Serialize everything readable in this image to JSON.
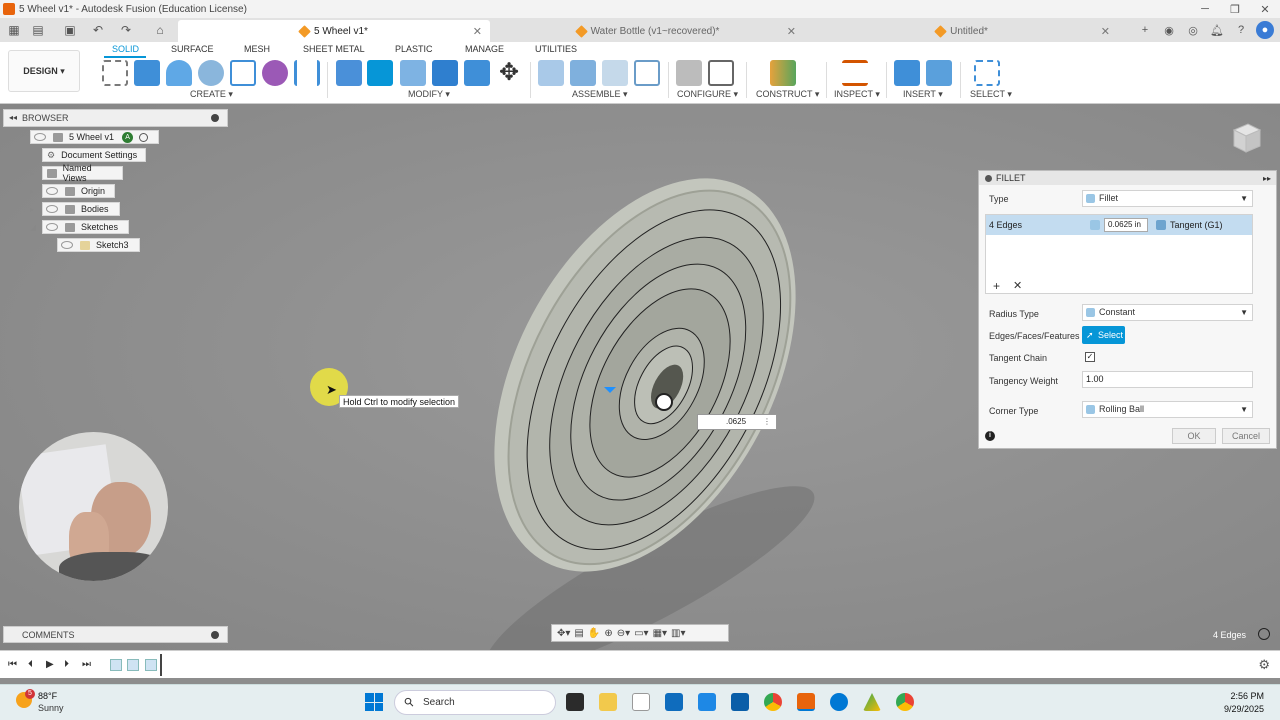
{
  "window": {
    "title": "5 Wheel v1* - Autodesk Fusion (Education License)"
  },
  "tabs": [
    {
      "label": "5 Wheel v1*",
      "active": true
    },
    {
      "label": "Water Bottle (v1~recovered)*",
      "active": false
    },
    {
      "label": "Untitled*",
      "active": false
    }
  ],
  "ribbon": {
    "workspace": "DESIGN",
    "workspace_tabs": [
      "SOLID",
      "SURFACE",
      "MESH",
      "SHEET METAL",
      "PLASTIC",
      "MANAGE",
      "UTILITIES"
    ],
    "groups": [
      "CREATE",
      "MODIFY",
      "ASSEMBLE",
      "CONFIGURE",
      "CONSTRUCT",
      "INSPECT",
      "INSERT",
      "SELECT"
    ]
  },
  "browser": {
    "header": "BROWSER",
    "root": "5 Wheel v1",
    "root_badge": "A",
    "items": [
      "Document Settings",
      "Named Views",
      "Origin",
      "Bodies",
      "Sketches",
      "Sketch3"
    ]
  },
  "tooltip": "Hold Ctrl to modify selection",
  "inline_value": ".0625",
  "fillet": {
    "title": "FILLET",
    "type_label": "Type",
    "type_value": "Fillet",
    "edges_label": "4 Edges",
    "radius": "0.0625 in",
    "continuity": "Tangent (G1)",
    "radius_type_label": "Radius Type",
    "radius_type_value": "Constant",
    "selection_label": "Edges/Faces/Features",
    "select_button": "Select",
    "tangent_chain_label": "Tangent Chain",
    "tangency_weight_label": "Tangency Weight",
    "tangency_weight_value": "1.00",
    "corner_type_label": "Corner Type",
    "corner_type_value": "Rolling Ball",
    "ok": "OK",
    "cancel": "Cancel"
  },
  "comments": "COMMENTS",
  "status": {
    "selection_count": "4 Edges"
  },
  "taskbar": {
    "weather_badge": "5",
    "temperature": "88°F",
    "condition": "Sunny",
    "search": "Search",
    "time": "2:56 PM",
    "date": "9/29/2025"
  },
  "colors": {
    "accent": "#0696d7",
    "fusion_orange": "#e8640c",
    "selection_row": "#c3dcf0"
  }
}
